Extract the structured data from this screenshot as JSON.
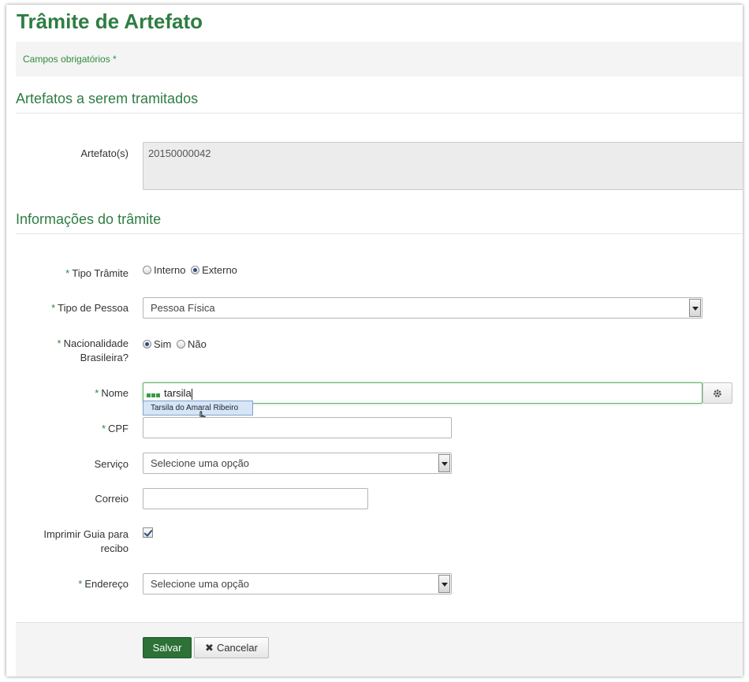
{
  "page": {
    "title": "Trâmite de Artefato",
    "required_note": "Campos obrigatórios *"
  },
  "sections": {
    "artefatos": {
      "title": "Artefatos a serem tramitados",
      "artefato_label": "Artefato(s)",
      "artefato_value": "20150000042"
    },
    "info": {
      "title": "Informações do trâmite"
    }
  },
  "form": {
    "tipo_tramite": {
      "label": "Tipo Trâmite",
      "options": [
        "Interno",
        "Externo"
      ],
      "selected": "Externo"
    },
    "tipo_pessoa": {
      "label": "Tipo de Pessoa",
      "value": "Pessoa Física"
    },
    "nacionalidade": {
      "label_line1": "Nacionalidade",
      "label_line2": "Brasileira?",
      "options": [
        "Sim",
        "Não"
      ],
      "selected": "Sim"
    },
    "nome": {
      "label": "Nome",
      "value": "tarsila",
      "suggestion": "Tarsila do Amaral Ribeiro"
    },
    "cpf": {
      "label": "CPF",
      "value": ""
    },
    "servico": {
      "label": "Serviço",
      "value": "Selecione uma opção"
    },
    "correio": {
      "label": "Correio",
      "value": ""
    },
    "imprimir_guia": {
      "label_line1": "Imprimir Guia para",
      "label_line2": "recibo",
      "checked": true
    },
    "endereco": {
      "label": "Endereço",
      "value": "Selecione uma opção"
    },
    "required_marker": "*"
  },
  "actions": {
    "save_label": "Salvar",
    "cancel_label": "Cancelar",
    "cancel_icon": "close-icon"
  },
  "colors": {
    "title_green": "#2e7d42",
    "save_button": "#2c7136",
    "suggestion_bg": "#d6e6f6"
  }
}
